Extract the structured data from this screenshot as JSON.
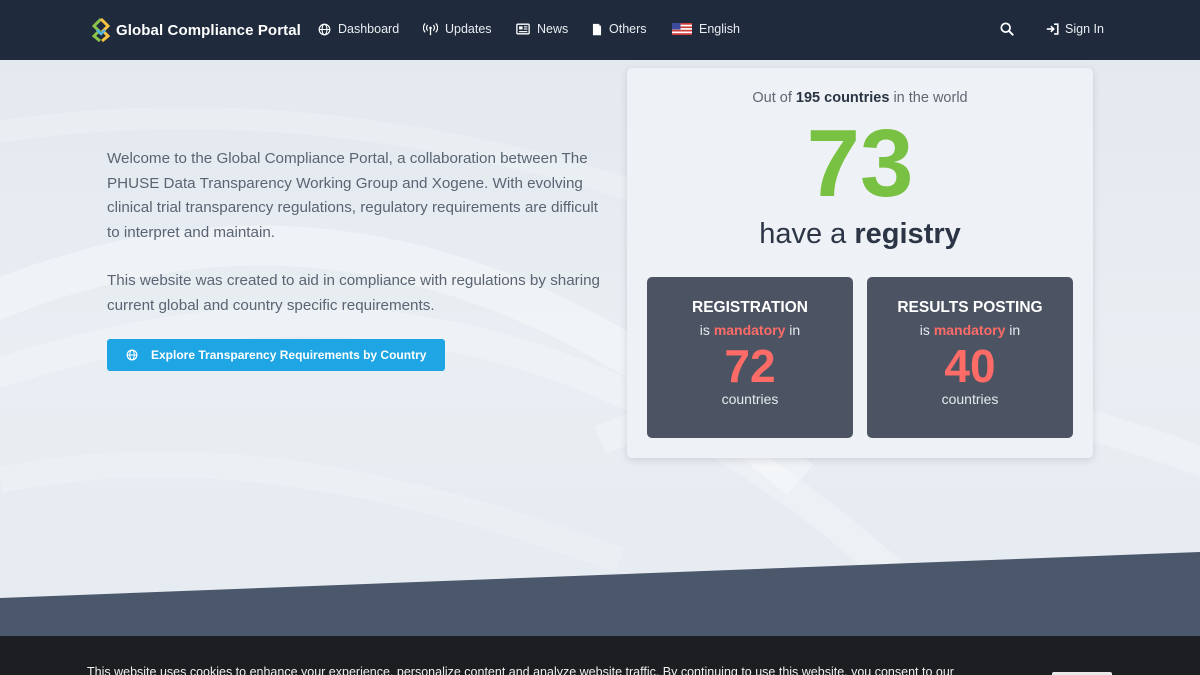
{
  "nav": {
    "brand": "Global Compliance Portal",
    "items": [
      {
        "label": "Dashboard",
        "icon": "globe-icon"
      },
      {
        "label": "Updates",
        "icon": "broadcast-icon"
      },
      {
        "label": "News",
        "icon": "newspaper-icon"
      },
      {
        "label": "Others",
        "icon": "file-icon"
      },
      {
        "label": "English",
        "icon": "us-flag-icon"
      }
    ],
    "search_icon": "search-icon",
    "signin_label": "Sign In"
  },
  "hero": {
    "intro_p1": "Welcome to the Global Compliance Portal, a collaboration between The PHUSE Data Transparency Working Group and Xogene. With evolving clinical trial transparency regulations, regulatory requirements are difficult to interpret and maintain.",
    "intro_p2": "This website was created to aid in compliance with regulations by sharing current global and country specific requirements.",
    "cta_label": "Explore Transparency Requirements by Country"
  },
  "stats": {
    "out_of_prefix": "Out of",
    "total_countries": "195 countries",
    "out_of_suffix": "in the world",
    "registry_count": "73",
    "have_a": "have a",
    "registry_word": "registry",
    "boxes": [
      {
        "title": "REGISTRATION",
        "is": "is",
        "mandatory": "mandatory",
        "in": "in",
        "count": "72",
        "unit": "countries"
      },
      {
        "title": "RESULTS POSTING",
        "is": "is",
        "mandatory": "mandatory",
        "in": "in",
        "count": "40",
        "unit": "countries"
      }
    ]
  },
  "cookie": {
    "text": "This website uses cookies to enhance your experience, personalize content and analyze website traffic. By continuing to use this website, you consent to our"
  },
  "colors": {
    "navbar": "#1f2a3c",
    "accent_blue": "#1ea5e4",
    "registry_green": "#79c143",
    "mandatory_red": "#ff6b66",
    "stat_box": "#4c5463",
    "slant": "#4b586b"
  }
}
